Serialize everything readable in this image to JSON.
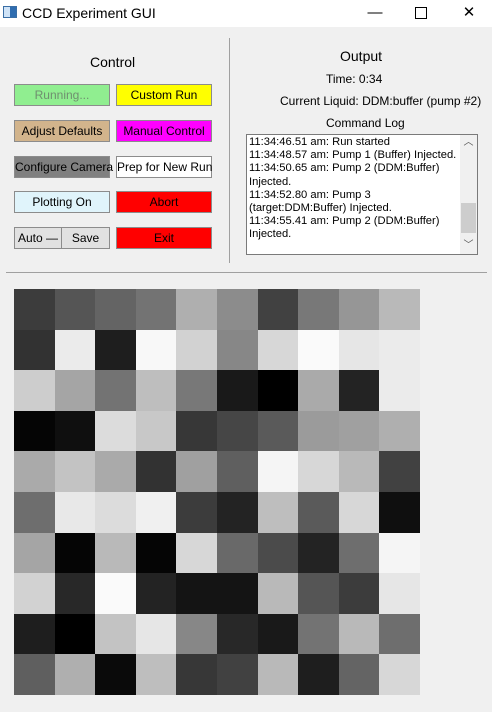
{
  "window": {
    "title": "CCD Experiment GUI",
    "min_glyph": "—",
    "close_glyph": "✕"
  },
  "control": {
    "title": "Control",
    "buttons": {
      "running": {
        "label": "Running...",
        "bg": "#90ee90",
        "fg": "#6f8f6f"
      },
      "custom_run": {
        "label": "Custom Run",
        "bg": "#ffff00"
      },
      "adjust_defaults": {
        "label": "Adjust Defaults",
        "bg": "#d2b48c"
      },
      "manual_control": {
        "label": "Manual Control",
        "bg": "#ff00ff"
      },
      "configure_camera": {
        "label": "Configure Camera",
        "bg": "#808080"
      },
      "prep_new_run": {
        "label": "Prep for New Run",
        "bg": "#ffffff"
      },
      "plotting_on": {
        "label": "Plotting On",
        "bg": "#e0f4fb"
      },
      "abort": {
        "label": "Abort",
        "bg": "#ff0000"
      },
      "auto": {
        "label": "Auto —"
      },
      "save": {
        "label": "Save"
      },
      "exit": {
        "label": "Exit",
        "bg": "#ff0000"
      }
    }
  },
  "output": {
    "title": "Output",
    "time_label": "Time:",
    "time_value": "0:34",
    "liquid_label": "Current Liquid:",
    "liquid_value": "DDM:buffer (pump #2)",
    "log_title": "Command Log",
    "log_lines": [
      "11:34:46.51 am: Run started",
      "11:34:48.57 am: Pump 1 (Buffer) Injected.",
      "11:34:50.65 am: Pump 2 (DDM:Buffer) Injected.",
      "11:34:52.80 am: Pump 3 (target:DDM:Buffer) Injected.",
      "11:34:55.41 am: Pump 2 (DDM:Buffer) Injected."
    ]
  },
  "image": {
    "rows": 10,
    "cols": 10,
    "gray_levels": [
      [
        60,
        85,
        100,
        115,
        175,
        140,
        65,
        120,
        150,
        185
      ],
      [
        50,
        235,
        30,
        248,
        210,
        135,
        215,
        250,
        230,
        235
      ],
      [
        205,
        165,
        115,
        190,
        120,
        25,
        0,
        170,
        35,
        235
      ],
      [
        5,
        15,
        220,
        200,
        55,
        70,
        90,
        155,
        160,
        175
      ],
      [
        170,
        195,
        170,
        50,
        160,
        95,
        245,
        215,
        185,
        65
      ],
      [
        110,
        232,
        220,
        240,
        60,
        35,
        190,
        90,
        215,
        15
      ],
      [
        165,
        5,
        185,
        5,
        215,
        105,
        75,
        35,
        110,
        245
      ],
      [
        210,
        40,
        250,
        35,
        20,
        20,
        185,
        85,
        60,
        230
      ],
      [
        30,
        0,
        195,
        230,
        135,
        40,
        25,
        115,
        185,
        110
      ],
      [
        95,
        175,
        10,
        190,
        55,
        65,
        185,
        30,
        100,
        215
      ]
    ]
  }
}
